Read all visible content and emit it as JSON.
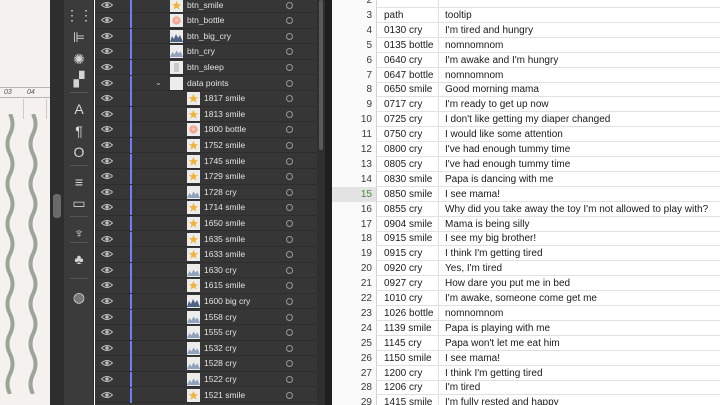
{
  "canvas": {
    "ruler_labels": [
      "03",
      "04"
    ],
    "wave_color": "#9aa598"
  },
  "tools": [
    {
      "icon": "align-icon",
      "glyph": "⋮⋮"
    },
    {
      "icon": "align-left-icon",
      "glyph": "⊫"
    },
    {
      "icon": "sun-icon",
      "glyph": "✺"
    },
    {
      "icon": "pathfinder-icon",
      "glyph": "▞"
    },
    {
      "icon": "character-icon",
      "glyph": "A"
    },
    {
      "icon": "paragraph-icon",
      "glyph": "¶"
    },
    {
      "icon": "opentype-icon",
      "glyph": "O"
    },
    {
      "icon": "stroke-icon",
      "glyph": "≡"
    },
    {
      "icon": "gradient-icon",
      "glyph": "▭"
    },
    {
      "icon": "puppet-icon",
      "glyph": "♆"
    },
    {
      "icon": "symbols-icon",
      "glyph": "♣"
    },
    {
      "icon": "appearance-icon",
      "glyph": "◍"
    }
  ],
  "layers": [
    {
      "name": "btn_smile",
      "thumb": "star",
      "child": false
    },
    {
      "name": "btn_bottle",
      "thumb": "bottle",
      "child": false
    },
    {
      "name": "btn_big_cry",
      "thumb": "bigcry",
      "child": false
    },
    {
      "name": "btn_cry",
      "thumb": "cry",
      "child": false
    },
    {
      "name": "btn_sleep",
      "thumb": "sleep",
      "child": false
    },
    {
      "name": "data points",
      "thumb": "blank",
      "child": false,
      "group": true,
      "disclose": "⌄"
    },
    {
      "name": "1817 smile",
      "thumb": "star",
      "child": true
    },
    {
      "name": "1813 smile",
      "thumb": "star",
      "child": true
    },
    {
      "name": "1800 bottle",
      "thumb": "bottle",
      "child": true
    },
    {
      "name": "1752 smile",
      "thumb": "star",
      "child": true
    },
    {
      "name": "1745 smile",
      "thumb": "star",
      "child": true
    },
    {
      "name": "1729 smile",
      "thumb": "star",
      "child": true
    },
    {
      "name": "1728 cry",
      "thumb": "cry",
      "child": true
    },
    {
      "name": "1714 smile",
      "thumb": "star",
      "child": true
    },
    {
      "name": "1650 smile",
      "thumb": "star",
      "child": true
    },
    {
      "name": "1635 smile",
      "thumb": "star",
      "child": true
    },
    {
      "name": "1633 smile",
      "thumb": "star",
      "child": true
    },
    {
      "name": "1630 cry",
      "thumb": "cry",
      "child": true
    },
    {
      "name": "1615 smile",
      "thumb": "star",
      "child": true
    },
    {
      "name": "1600 big cry",
      "thumb": "bigcry",
      "child": true
    },
    {
      "name": "1558 cry",
      "thumb": "cry",
      "child": true
    },
    {
      "name": "1555 cry",
      "thumb": "cry",
      "child": true
    },
    {
      "name": "1532 cry",
      "thumb": "cry",
      "child": true
    },
    {
      "name": "1528 cry",
      "thumb": "cry",
      "child": true
    },
    {
      "name": "1522 cry",
      "thumb": "cry",
      "child": true
    },
    {
      "name": "1521 smile",
      "thumb": "star",
      "child": true
    }
  ],
  "sheet": {
    "rows": [
      {
        "n": "2",
        "a": "",
        "b": ""
      },
      {
        "n": "3",
        "a": "path",
        "b": "tooltip"
      },
      {
        "n": "4",
        "a": "0130 cry",
        "b": "I'm tired and hungry"
      },
      {
        "n": "5",
        "a": "0135 bottle",
        "b": "nomnomnom"
      },
      {
        "n": "6",
        "a": "0640 cry",
        "b": "I'm awake and I'm hungry"
      },
      {
        "n": "7",
        "a": "0647 bottle",
        "b": "nomnomnom"
      },
      {
        "n": "8",
        "a": "0650 smile",
        "b": "Good morning mama"
      },
      {
        "n": "9",
        "a": "0717 cry",
        "b": "I'm ready to get up now"
      },
      {
        "n": "10",
        "a": "0725 cry",
        "b": "I don't like getting my diaper changed"
      },
      {
        "n": "11",
        "a": "0750 cry",
        "b": "I would like some attention"
      },
      {
        "n": "12",
        "a": "0800 cry",
        "b": "I've had enough tummy time"
      },
      {
        "n": "13",
        "a": "0805 cry",
        "b": "I've had enough tummy time"
      },
      {
        "n": "14",
        "a": "0830 smile",
        "b": "Papa is dancing with me"
      },
      {
        "n": "15",
        "a": "0850 smile",
        "b": "I see mama!",
        "selected": true
      },
      {
        "n": "16",
        "a": "0855 cry",
        "b": "Why did you take away the toy I'm not allowed to play with?"
      },
      {
        "n": "17",
        "a": "0904 smile",
        "b": "Mama is being silly"
      },
      {
        "n": "18",
        "a": "0915 smile",
        "b": "I see my big brother!"
      },
      {
        "n": "19",
        "a": "0915 cry",
        "b": "I think I'm getting tired"
      },
      {
        "n": "20",
        "a": "0920 cry",
        "b": "Yes, I'm tired"
      },
      {
        "n": "21",
        "a": "0927 cry",
        "b": "How dare you put me in bed"
      },
      {
        "n": "22",
        "a": "1010 cry",
        "b": "I'm awake, someone come get me"
      },
      {
        "n": "23",
        "a": "1026 bottle",
        "b": "nomnomnom"
      },
      {
        "n": "24",
        "a": "1139 smile",
        "b": "Papa is playing with me"
      },
      {
        "n": "25",
        "a": "1145 cry",
        "b": "Papa won't let me eat him"
      },
      {
        "n": "26",
        "a": "1150 smile",
        "b": "I see mama!"
      },
      {
        "n": "27",
        "a": "1200 cry",
        "b": "I think I'm getting tired"
      },
      {
        "n": "28",
        "a": "1206 cry",
        "b": "I'm tired"
      },
      {
        "n": "29",
        "a": "1415 smile",
        "b": "I'm fully rested and happy"
      }
    ]
  }
}
